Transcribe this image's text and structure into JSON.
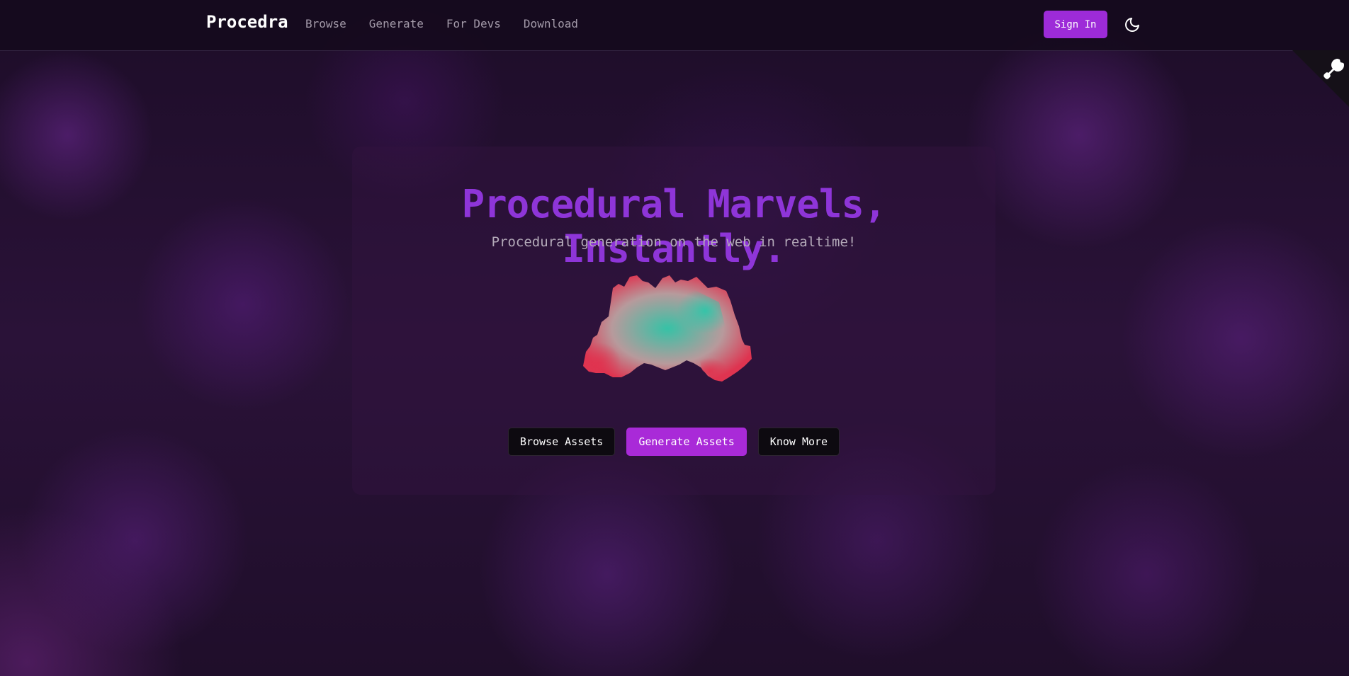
{
  "nav": {
    "brand": "Procedra",
    "links": [
      "Browse",
      "Generate",
      "For Devs",
      "Download"
    ],
    "sign_in": "Sign In",
    "theme_icon": "moon-icon"
  },
  "corner": {
    "icon": "github-octocat-icon"
  },
  "hero": {
    "title": "Procedural Marvels, Instantly.",
    "subtitle": "Procedural generation on the web in realtime!",
    "image": "procedural-terrain-render",
    "buttons": {
      "browse": "Browse Assets",
      "generate": "Generate Assets",
      "know_more": "Know More"
    }
  },
  "colors": {
    "accent": "#9d2bd8",
    "title": "#8e35d8",
    "terrain_teal": "#3fbfa8",
    "terrain_red": "#e0334f"
  }
}
